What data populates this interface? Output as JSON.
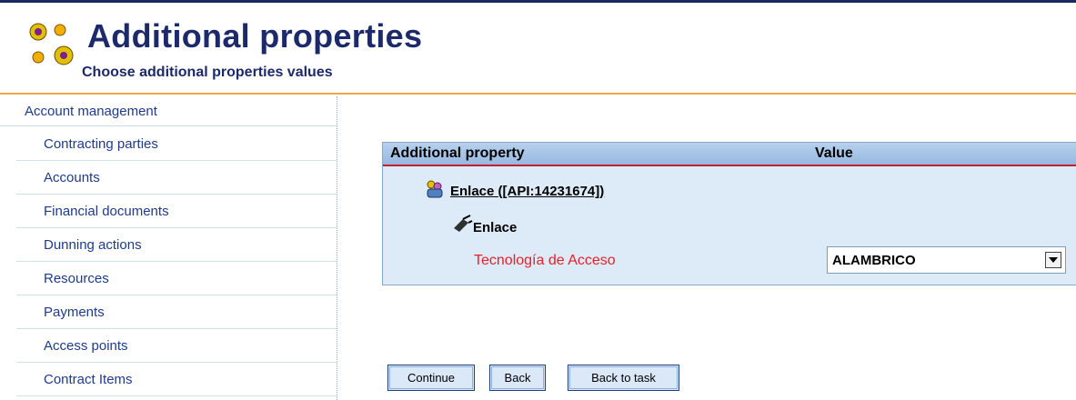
{
  "header": {
    "title": "Additional properties",
    "subtitle": "Choose additional properties values",
    "icon": "people-gear-icon"
  },
  "sidebar": {
    "heading": "Account management",
    "items": [
      {
        "label": "Contracting parties"
      },
      {
        "label": "Accounts"
      },
      {
        "label": "Financial documents"
      },
      {
        "label": "Dunning actions"
      },
      {
        "label": "Resources"
      },
      {
        "label": "Payments"
      },
      {
        "label": "Access points"
      },
      {
        "label": "Contract Items"
      }
    ]
  },
  "table": {
    "col_property": "Additional property",
    "col_value": "Value",
    "group": {
      "label": "Enlace ([API:14231674])",
      "icon": "users-icon"
    },
    "subgroup": {
      "label": "Enlace",
      "icon": "cable-icon"
    },
    "property": {
      "name": "Tecnología de Acceso",
      "value": "ALAMBRICO",
      "name_color": "#e8202a"
    }
  },
  "buttons": {
    "continue": "Continue",
    "back": "Back",
    "back_to_task": "Back to task"
  },
  "colors": {
    "title": "#1c2a6b",
    "header_rule": "#f0a84a",
    "table_bg": "#dcebf7",
    "table_header_rule": "#c02030",
    "nav_text": "#1f3b8c"
  }
}
